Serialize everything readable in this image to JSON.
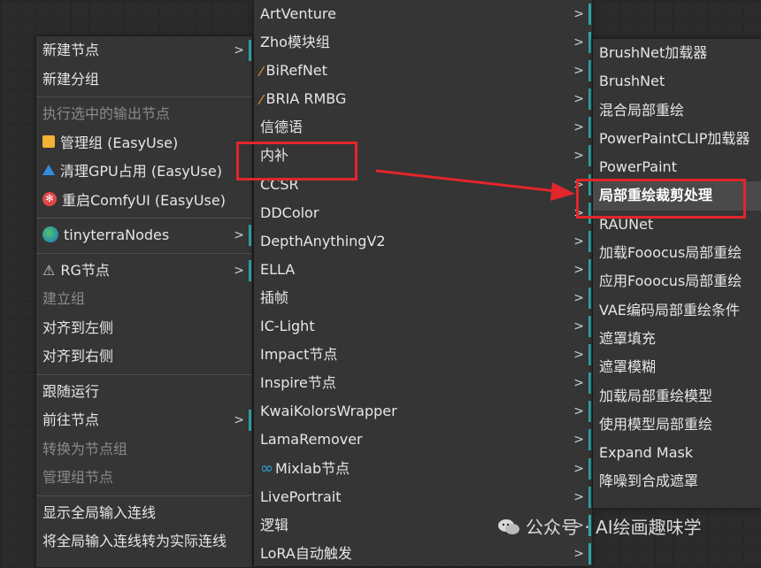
{
  "menu1": {
    "items": [
      {
        "label": "新建节点",
        "submenu": true
      },
      {
        "label": "新建分组"
      },
      {
        "sep": true
      },
      {
        "label": "执行选中的输出节点",
        "disabled": true
      },
      {
        "label": "管理组 (EasyUse)",
        "icon": "folder-icon"
      },
      {
        "label": "清理GPU占用 (EasyUse)",
        "icon": "rocket-icon"
      },
      {
        "label": "重启ComfyUI (EasyUse)",
        "icon": "restart-icon"
      },
      {
        "sep": true
      },
      {
        "label": "tinyterraNodes",
        "icon": "globe-icon",
        "submenu": true
      },
      {
        "sep": true
      },
      {
        "label": "RG节点",
        "icon": "rg-logo-icon",
        "submenu": true
      },
      {
        "label": "建立组",
        "disabled": true
      },
      {
        "label": "对齐到左侧"
      },
      {
        "label": "对齐到右侧"
      },
      {
        "sep": true
      },
      {
        "label": "跟随运行"
      },
      {
        "label": "前往节点",
        "submenu": true
      },
      {
        "label": "转换为节点组",
        "disabled": true
      },
      {
        "label": "管理组节点",
        "disabled": true
      },
      {
        "sep": true
      },
      {
        "label": "显示全局输入连线"
      },
      {
        "label": "将全局输入连线转为实际连线"
      }
    ]
  },
  "menu2": {
    "items": [
      {
        "label": "ArtVenture",
        "submenu": true
      },
      {
        "label": "Zho模块组",
        "submenu": true
      },
      {
        "label": "BiRefNet",
        "icon": "brush-icon",
        "submenu": true
      },
      {
        "label": "BRIA RMBG",
        "icon": "brush-icon",
        "submenu": true
      },
      {
        "label": "信德语",
        "submenu": true
      },
      {
        "label": "内补",
        "submenu": true
      },
      {
        "label": "CCSR",
        "submenu": true
      },
      {
        "label": "DDColor",
        "submenu": true
      },
      {
        "label": "DepthAnythingV2",
        "submenu": true
      },
      {
        "label": "ELLA",
        "submenu": true
      },
      {
        "label": "插帧",
        "submenu": true
      },
      {
        "label": "IC-Light",
        "submenu": true
      },
      {
        "label": "Impact节点",
        "submenu": true
      },
      {
        "label": "Inspire节点",
        "submenu": true
      },
      {
        "label": "KwaiKolorsWrapper",
        "submenu": true
      },
      {
        "label": "LamaRemover",
        "submenu": true
      },
      {
        "label": "Mixlab节点",
        "icon": "infinity-icon",
        "submenu": true
      },
      {
        "label": "LivePortrait",
        "submenu": true
      },
      {
        "label": "逻辑",
        "submenu": true
      },
      {
        "label": "LoRA自动触发",
        "submenu": true
      }
    ]
  },
  "menu3": {
    "items": [
      {
        "label": "BrushNet加载器"
      },
      {
        "label": "BrushNet"
      },
      {
        "label": "混合局部重绘"
      },
      {
        "label": "PowerPaintCLIP加载器"
      },
      {
        "label": "PowerPaint"
      },
      {
        "label": "局部重绘裁剪处理",
        "highlight": true
      },
      {
        "label": "RAUNet"
      },
      {
        "label": "加载Fooocus局部重绘"
      },
      {
        "label": "应用Fooocus局部重绘"
      },
      {
        "label": "VAE编码局部重绘条件"
      },
      {
        "label": "遮罩填充"
      },
      {
        "label": "遮罩模糊"
      },
      {
        "label": "加载局部重绘模型"
      },
      {
        "label": "使用模型局部重绘"
      },
      {
        "label": "Expand Mask"
      },
      {
        "label": "降噪到合成遮罩"
      }
    ]
  },
  "arrow_glyph": ">",
  "watermark": {
    "text": "公众号 · AI绘画趣味学",
    "icon": "wechat-icon"
  },
  "colors": {
    "accent": "#2fa4a4",
    "annotation_red": "#e2262c",
    "menu_bg": "#353535",
    "highlight_bg": "#4a4a4a"
  }
}
